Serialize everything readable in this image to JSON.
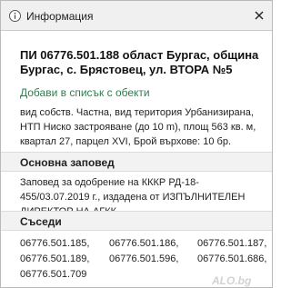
{
  "window": {
    "title": "Информация",
    "icons": [
      "info-icon",
      "close-icon"
    ]
  },
  "address": "ПИ 06776.501.188 област Бургас, община Бургас, с. Брястовец, ул. ВТОРА №5",
  "add_link": "Добави в списък с обекти",
  "description": "вид собств. Частна, вид територия Урбанизирана, НТП Ниско застрояване (до 10 m), площ 563 кв. м, квартал 27, парцел XVI, Брой върхове: 10 бр.",
  "order_section": {
    "heading": "Основна заповед",
    "text": "Заповед за одобрение на КККР РД-18-455/03.07.2019 г., издадена от ИЗПЪЛНИТЕЛЕН ДИРЕКТОР НА АГКК"
  },
  "neighbors_section": {
    "heading": "Съседи",
    "items": [
      "06776.501.185,",
      "06776.501.186,",
      "06776.501.187,",
      "06776.501.189,",
      "06776.501.596,",
      "06776.501.686,",
      "06776.501.709"
    ]
  },
  "watermark": "ALO.bg",
  "colors": {
    "link": "#2e7d4f",
    "titlebar_bg": "#f0f0f0",
    "section_bg": "#f2f2f2"
  }
}
